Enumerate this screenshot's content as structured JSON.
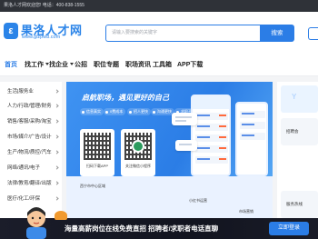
{
  "topbar": {
    "text": "果洛人才网欢迎您! 电话：400-838-1555"
  },
  "header": {
    "logo_mark": "ε",
    "logo_name": "果洛人才网",
    "logo_url": "www.glzpw8.com",
    "search_placeholder": "请输入要搜索的关键字",
    "search_button": "搜索"
  },
  "nav": {
    "items": [
      {
        "label": "首页",
        "active": true
      },
      {
        "label": "找工作",
        "has_dropdown": true
      },
      {
        "label": "找企业",
        "has_dropdown": true
      },
      {
        "label": "公招"
      },
      {
        "label": "职位专题"
      },
      {
        "label": "职场资讯"
      },
      {
        "label": "工具箱"
      },
      {
        "label": "APP下载"
      }
    ]
  },
  "sidebar": {
    "items": [
      "生活|服务业",
      "人力/行政/管理/财务",
      "销售/客服/采购/淘宝",
      "市场/媒介/广告/设计",
      "生产/物流/质控/汽车",
      "网络/通讯/电子",
      "法律/教育/翻译/出版",
      "医疗/化工/环保"
    ]
  },
  "banner": {
    "headline": "启航职场，遇见更好的自己",
    "pills": [
      "信息真实",
      "0费成本",
      "招人更快",
      "沟通更快",
      "求职不求"
    ],
    "qr_left_label": "扫码下载APP",
    "qr_right_label": "关注微信小程序",
    "bottom_left": "西宁市中心区域",
    "bottom_mid": "小红书运营",
    "bottom_right": "市场营销"
  },
  "right_panel": {
    "letter": "Y",
    "text1": "招聘会",
    "text2": "服务热线"
  },
  "promo": {
    "text": "海量高薪岗位在线免费直招 招聘者/求职者电话直聊",
    "button": "立即登录"
  }
}
